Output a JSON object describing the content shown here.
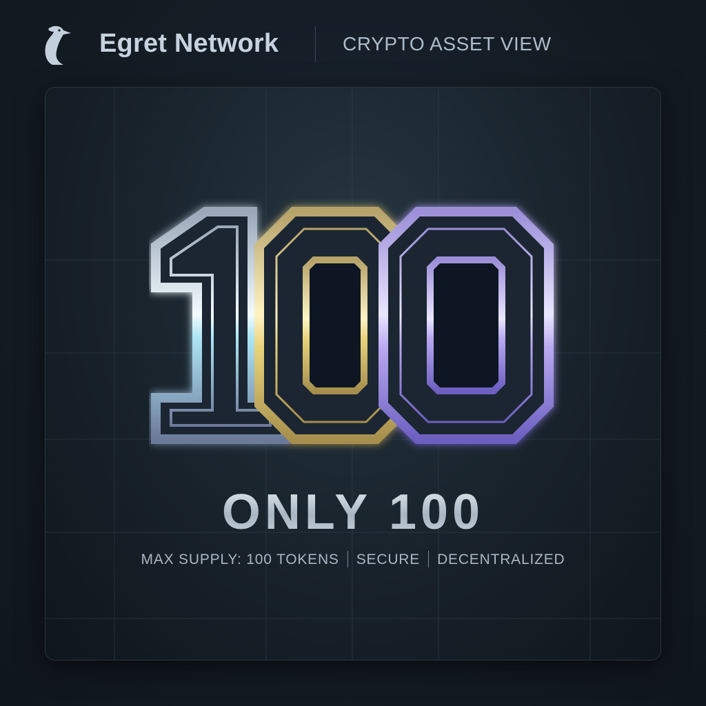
{
  "header": {
    "brand": "Egret Network",
    "view_title": "CRYPTO ASSET VIEW",
    "logo_icon": "egret-head-icon"
  },
  "hero": {
    "number": "100",
    "tagline": "ONLY 100",
    "details": [
      "MAX SUPPLY: 100 TOKENS",
      "SECURE",
      "DECENTRALIZED"
    ]
  },
  "colors": {
    "background": "#131b23",
    "card": "#1b2631",
    "digit_one": "#aee6f5",
    "digit_zero_gold": "#e8d27a",
    "digit_zero_violet": "#b7a8f0",
    "text_muted": "#aab6c2"
  }
}
